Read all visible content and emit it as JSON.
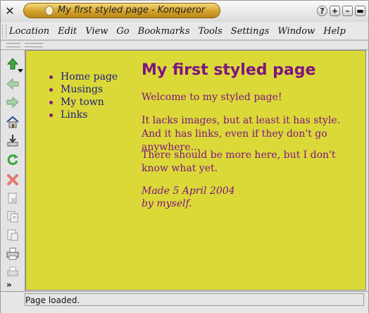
{
  "window": {
    "title": "My first styled page - Konqueror",
    "controls": [
      "help",
      "maximize",
      "minimize",
      "close"
    ]
  },
  "menubar": {
    "items": [
      "Location",
      "Edit",
      "View",
      "Go",
      "Bookmarks",
      "Tools",
      "Settings",
      "Window",
      "Help"
    ]
  },
  "toolbar": {
    "buttons": [
      {
        "icon": "up-arrow-icon"
      },
      {
        "icon": "back-arrow-icon"
      },
      {
        "icon": "forward-arrow-icon"
      },
      {
        "icon": "home-icon"
      },
      {
        "icon": "download-icon"
      },
      {
        "icon": "reload-icon"
      },
      {
        "icon": "stop-icon"
      },
      {
        "icon": "cut-icon"
      },
      {
        "icon": "copy-icon"
      },
      {
        "icon": "paste-icon"
      },
      {
        "icon": "print-icon"
      },
      {
        "icon": "print-preview-icon"
      }
    ],
    "more_label": "»",
    "colors": {
      "green": "#3aa83a",
      "red": "#d63a2a",
      "gray": "#9a9a9a"
    }
  },
  "page": {
    "background": "#dbd938",
    "text_color": "#7e1480",
    "link_color": "#1a1a80",
    "nav": [
      "Home page",
      "Musings",
      "My town",
      "Links"
    ],
    "heading": "My first styled page",
    "paragraphs": [
      "Welcome to my styled page!",
      "It lacks images, but at least it has style. And it has links, even if they don't go anywhere…",
      "There should be more here, but I don't know what yet."
    ],
    "signature": {
      "line1": "Made 5 April 2004",
      "line2": "by myself."
    }
  },
  "status": {
    "text": "Page loaded."
  }
}
